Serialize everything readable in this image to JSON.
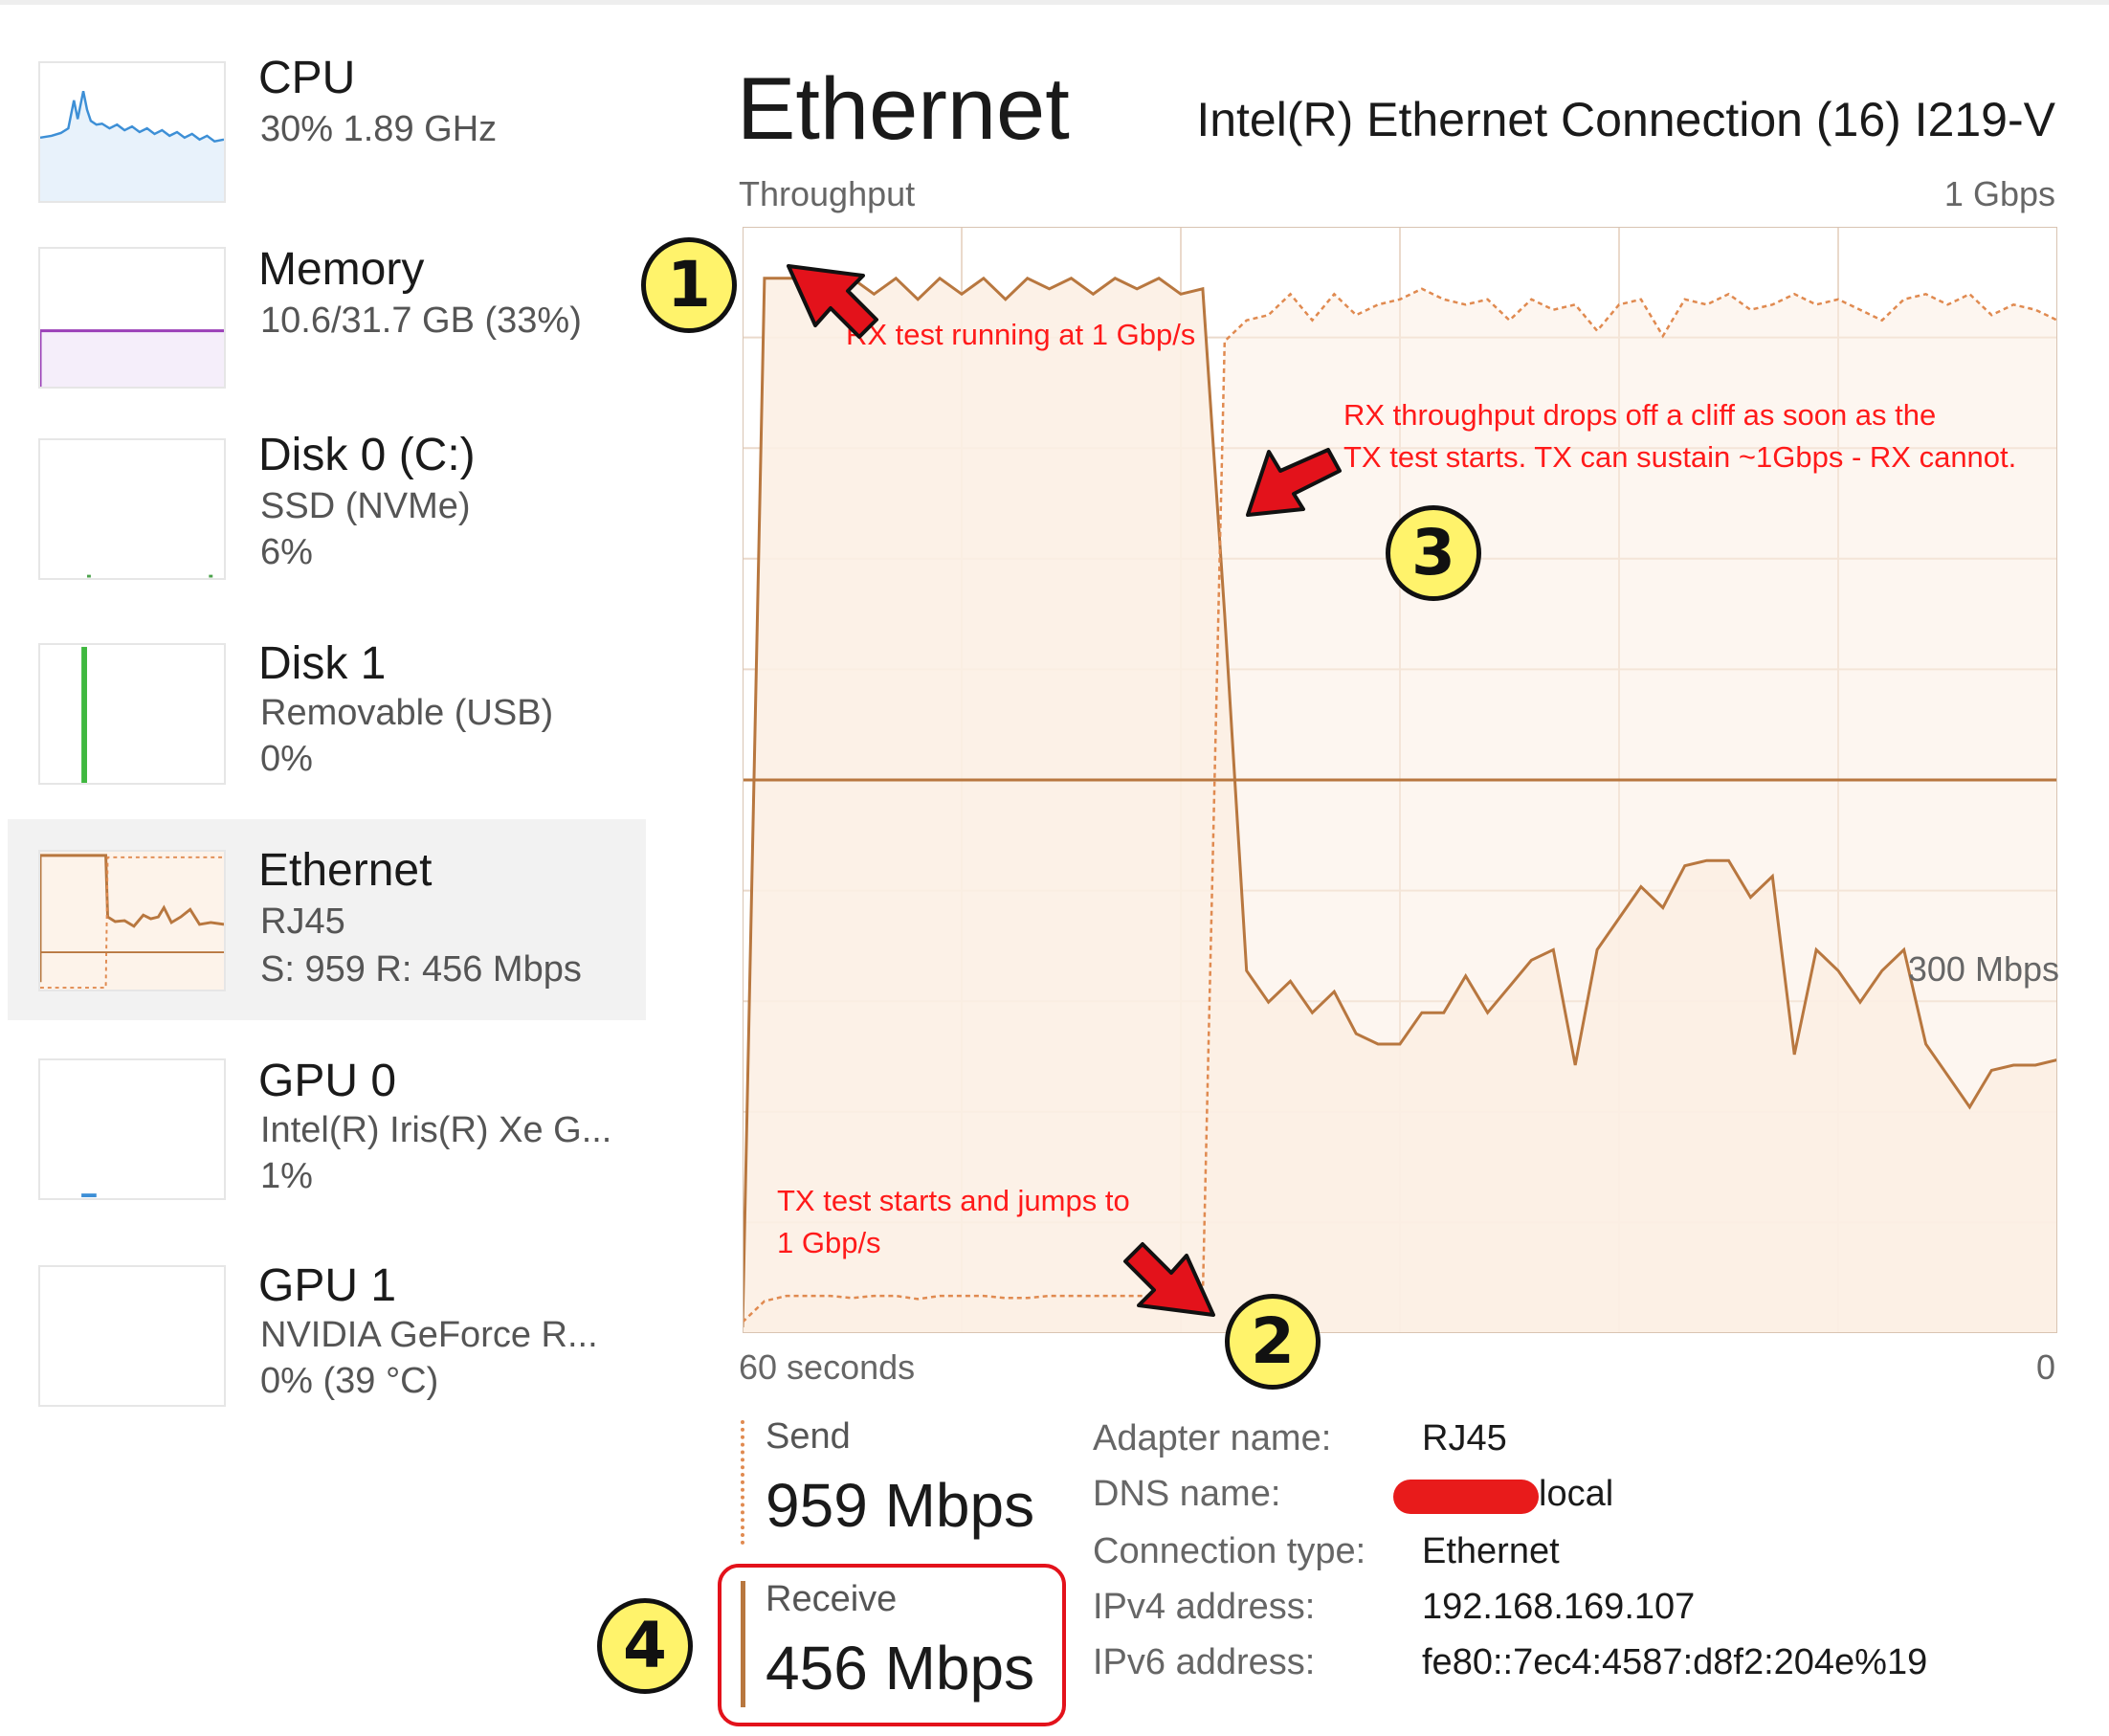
{
  "sidebar": {
    "items": [
      {
        "name": "CPU",
        "line1": "30%  1.89 GHz",
        "line2": ""
      },
      {
        "name": "Memory",
        "line1": "10.6/31.7 GB (33%)",
        "line2": ""
      },
      {
        "name": "Disk 0 (C:)",
        "line1": "SSD (NVMe)",
        "line2": "6%"
      },
      {
        "name": "Disk 1",
        "line1": "Removable (USB)",
        "line2": "0%"
      },
      {
        "name": "Ethernet",
        "line1": "RJ45",
        "line2": "S: 959  R: 456 Mbps"
      },
      {
        "name": "GPU 0",
        "line1": "Intel(R) Iris(R) Xe G...",
        "line2": "1%"
      },
      {
        "name": "GPU 1",
        "line1": "NVIDIA GeForce R...",
        "line2": "0%  (39 °C)"
      }
    ],
    "selected_index": 4
  },
  "header": {
    "title": "Ethernet",
    "adapter_model": "Intel(R) Ethernet Connection (16) I219-V",
    "chart_label": "Throughput",
    "chart_max": "1 Gbps",
    "chart_mid": "300 Mbps",
    "time_left": "60 seconds",
    "time_right": "0"
  },
  "annotations": {
    "note1": "RX test running at 1 Gbp/s",
    "note2_line1": "TX test starts and jumps to",
    "note2_line2": "1 Gbp/s",
    "note3_line1": "RX throughput drops off a cliff as soon as the",
    "note3_line2": "TX test starts. TX can sustain ~1Gbps - RX cannot.",
    "badges": [
      "1",
      "2",
      "3",
      "4"
    ]
  },
  "stats": {
    "send_label": "Send",
    "send_value": "959 Mbps",
    "receive_label": "Receive",
    "receive_value": "456 Mbps"
  },
  "properties": {
    "adapter_name_label": "Adapter name:",
    "adapter_name_value": "RJ45",
    "dns_name_label": "DNS name:",
    "dns_name_value": "local",
    "connection_type_label": "Connection type:",
    "connection_type_value": "Ethernet",
    "ipv4_label": "IPv4 address:",
    "ipv4_value": "192.168.169.107",
    "ipv6_label": "IPv6 address:",
    "ipv6_value": "fe80::7ec4:4587:d8f2:204e%19"
  },
  "colors": {
    "receive_line": "#b8773f",
    "send_line": "#e08a50",
    "chart_fill": "#fcefe4",
    "grid": "#ead9cb",
    "annotation_red": "#ff1a1a",
    "badge_yellow": "#fff36b"
  },
  "chart_data": {
    "type": "line",
    "x_unit": "seconds ago",
    "x_range": [
      60,
      0
    ],
    "y_max_label": "1 Gbps",
    "y_axis_scale": "auto (top = 1 Gbps)",
    "series": [
      {
        "name": "Receive",
        "style": "solid",
        "points": [
          [
            60,
            0
          ],
          [
            59,
            1000
          ],
          [
            58,
            1000
          ],
          [
            57,
            1000
          ],
          [
            56,
            990
          ],
          [
            55,
            1000
          ],
          [
            54,
            985
          ],
          [
            53,
            1000
          ],
          [
            52,
            980
          ],
          [
            51,
            1000
          ],
          [
            50,
            985
          ],
          [
            49,
            1000
          ],
          [
            48,
            980
          ],
          [
            47,
            1000
          ],
          [
            46,
            990
          ],
          [
            45,
            1000
          ],
          [
            44,
            985
          ],
          [
            43,
            1000
          ],
          [
            42,
            990
          ],
          [
            41,
            1000
          ],
          [
            40,
            985
          ],
          [
            39,
            990
          ],
          [
            38,
            680
          ],
          [
            37,
            340
          ],
          [
            36,
            310
          ],
          [
            35,
            330
          ],
          [
            34,
            300
          ],
          [
            33,
            320
          ],
          [
            32,
            280
          ],
          [
            31,
            270
          ],
          [
            30,
            270
          ],
          [
            29,
            300
          ],
          [
            28,
            300
          ],
          [
            27,
            335
          ],
          [
            26,
            300
          ],
          [
            25,
            325
          ],
          [
            24,
            350
          ],
          [
            23,
            360
          ],
          [
            22,
            250
          ],
          [
            21,
            360
          ],
          [
            20,
            390
          ],
          [
            19,
            420
          ],
          [
            18,
            400
          ],
          [
            17,
            440
          ],
          [
            16,
            445
          ],
          [
            15,
            445
          ],
          [
            14,
            410
          ],
          [
            13,
            430
          ],
          [
            12,
            260
          ],
          [
            11,
            360
          ],
          [
            10,
            340
          ],
          [
            9,
            310
          ],
          [
            8,
            340
          ],
          [
            7,
            360
          ],
          [
            6,
            270
          ],
          [
            5,
            240
          ],
          [
            4,
            210
          ],
          [
            3,
            245
          ],
          [
            2,
            250
          ],
          [
            1,
            250
          ],
          [
            0,
            255
          ]
        ]
      },
      {
        "name": "Send",
        "style": "dashed",
        "points": [
          [
            60,
            5
          ],
          [
            59,
            25
          ],
          [
            58,
            30
          ],
          [
            57,
            30
          ],
          [
            56,
            30
          ],
          [
            55,
            28
          ],
          [
            54,
            30
          ],
          [
            53,
            30
          ],
          [
            52,
            27
          ],
          [
            51,
            30
          ],
          [
            50,
            30
          ],
          [
            49,
            30
          ],
          [
            48,
            28
          ],
          [
            47,
            28
          ],
          [
            46,
            30
          ],
          [
            45,
            30
          ],
          [
            44,
            30
          ],
          [
            43,
            30
          ],
          [
            42,
            30
          ],
          [
            41,
            30
          ],
          [
            40,
            30
          ],
          [
            39,
            28
          ],
          [
            38,
            940
          ],
          [
            37,
            960
          ],
          [
            36,
            965
          ],
          [
            35,
            985
          ],
          [
            34,
            960
          ],
          [
            33,
            985
          ],
          [
            32,
            965
          ],
          [
            31,
            975
          ],
          [
            30,
            980
          ],
          [
            29,
            990
          ],
          [
            28,
            980
          ],
          [
            27,
            975
          ],
          [
            26,
            980
          ],
          [
            25,
            960
          ],
          [
            24,
            980
          ],
          [
            23,
            970
          ],
          [
            22,
            975
          ],
          [
            21,
            950
          ],
          [
            20,
            975
          ],
          [
            19,
            980
          ],
          [
            18,
            945
          ],
          [
            17,
            980
          ],
          [
            16,
            975
          ],
          [
            15,
            985
          ],
          [
            14,
            970
          ],
          [
            13,
            975
          ],
          [
            12,
            985
          ],
          [
            11,
            975
          ],
          [
            10,
            980
          ],
          [
            9,
            970
          ],
          [
            8,
            960
          ],
          [
            7,
            980
          ],
          [
            6,
            985
          ],
          [
            5,
            975
          ],
          [
            4,
            985
          ],
          [
            3,
            965
          ],
          [
            2,
            975
          ],
          [
            1,
            970
          ],
          [
            0,
            960
          ]
        ]
      }
    ]
  }
}
